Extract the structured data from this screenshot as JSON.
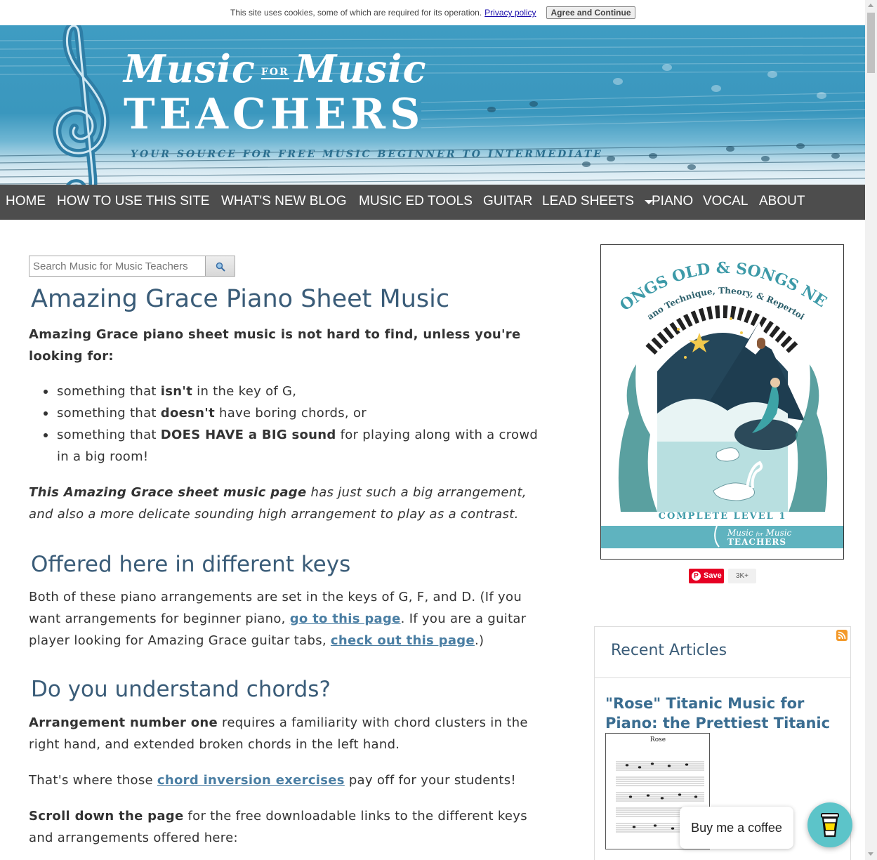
{
  "cookie": {
    "message": "This site uses cookies, some of which are required for its operation.",
    "privacy_link": "Privacy policy",
    "agree_button": "Agree and Continue"
  },
  "banner": {
    "line1_a": "Music",
    "line1_for": "FOR",
    "line1_b": "Music",
    "line2": "TEACHERS",
    "tagline": "YOUR SOURCE FOR FREE MUSIC BEGINNER TO INTERMEDIATE"
  },
  "nav": {
    "items": [
      "HOME",
      "HOW TO USE THIS SITE",
      "WHAT'S NEW BLOG",
      "MUSIC ED TOOLS",
      "GUITAR",
      "LEAD SHEETS",
      "PIANO",
      "VOCAL",
      "ABOUT"
    ]
  },
  "search": {
    "placeholder": "Search Music for Music Teachers",
    "icon": "search-icon"
  },
  "article": {
    "title": "Amazing Grace Piano Sheet Music",
    "intro": "Amazing Grace piano sheet music is not hard to find, unless you're looking for:",
    "bullets": [
      {
        "pre": "something that ",
        "bold": "isn't",
        "post": " in the key of G,"
      },
      {
        "pre": "something that ",
        "bold": "doesn't",
        "post": " have boring chords, or"
      },
      {
        "pre": "something that ",
        "bold": "DOES HAVE a BIG sound",
        "post": " for playing along with a crowd in a big room!"
      }
    ],
    "p2_bold": "This Amazing Grace sheet music page",
    "p2_rest": " has just such a big arrangement, and also a more delicate sounding high arrangement to play as a contrast.",
    "h2_keys": "Offered here in different keys",
    "p3_a": "Both of these piano arrangements are set in the keys of G, F, and D.  (If you want arrangements for beginner piano, ",
    "p3_link1": "go to this page",
    "p3_b": ".  If you are a guitar player looking for Amazing Grace guitar tabs, ",
    "p3_link2": "check out this page",
    "p3_c": ".)",
    "h2_chords": "Do you understand chords?",
    "p4_bold": "Arrangement number one",
    "p4_rest": " requires a familiarity with chord clusters in the right hand, and extended broken chords in the left hand.",
    "p5_a": "That's where those ",
    "p5_link": "chord inversion exercises",
    "p5_b": " pay off for your students!",
    "p6_bold": "Scroll down the page",
    "p6_rest": " for the free downloadable links to the different keys and arrangements offered here:"
  },
  "sidebar": {
    "book": {
      "arc_title": "SONGS OLD & SONGS NEW",
      "arc_subtitle": "Piano Technique, Theory, & Repertoire",
      "level": "COMPLETE LEVEL 1",
      "brand_a": "Music",
      "brand_for": "for",
      "brand_b": "Music",
      "brand_c": "TEACHERS"
    },
    "pinterest": {
      "save_label": "Save",
      "count": "3K+"
    },
    "recent": {
      "heading": "Recent Articles",
      "article_title": "\"Rose\" Titanic Music for Piano: the Prettiest Titanic Song?",
      "thumb_title": "Rose"
    }
  },
  "coffee": {
    "label": "Buy me a coffee"
  },
  "colors": {
    "nav_bg": "#4d4d4d",
    "heading": "#3a5c78",
    "link": "#4a7ea3",
    "banner": "#3f9cc2",
    "coffee": "#5cc4c9",
    "pinterest": "#e60023"
  }
}
